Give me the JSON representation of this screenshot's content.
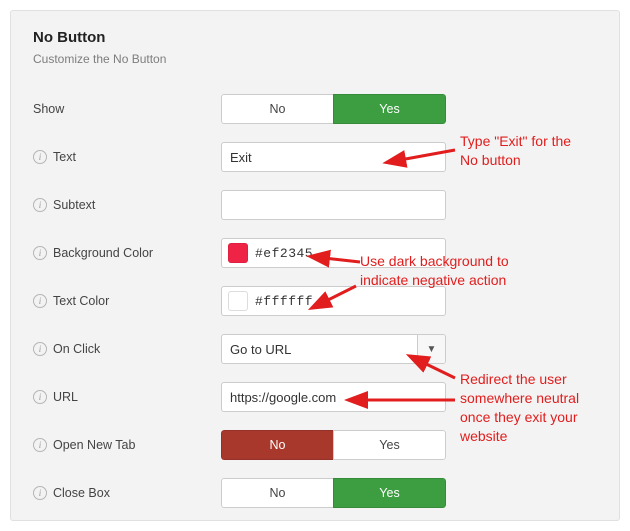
{
  "panel": {
    "title": "No Button",
    "subtitle": "Customize the No Button"
  },
  "rows": {
    "show": {
      "label": "Show",
      "no": "No",
      "yes": "Yes"
    },
    "text": {
      "label": "Text",
      "value": "Exit"
    },
    "subtext": {
      "label": "Subtext",
      "value": ""
    },
    "bgcolor": {
      "label": "Background Color",
      "value": "#ef2345"
    },
    "textcolor": {
      "label": "Text Color",
      "value": "#ffffff"
    },
    "onclick": {
      "label": "On Click",
      "value": "Go to URL"
    },
    "url": {
      "label": "URL",
      "value": "https://google.com"
    },
    "newtab": {
      "label": "Open New Tab",
      "no": "No",
      "yes": "Yes"
    },
    "closebox": {
      "label": "Close Box",
      "no": "No",
      "yes": "Yes"
    }
  },
  "annotations": {
    "a1": "Type \"Exit\" for the\nNo button",
    "a2": "Use dark background to\nindicate negative action",
    "a3": "Redirect the user\nsomewhere neutral\nonce they exit your\nwebsite"
  }
}
